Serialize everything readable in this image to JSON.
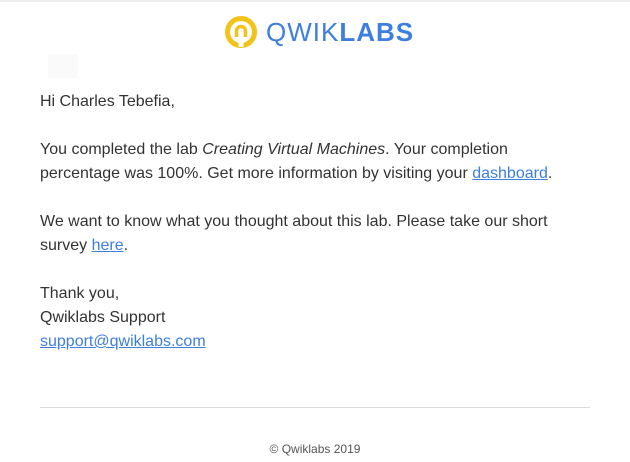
{
  "logo": {
    "text_light": "QWIK",
    "text_bold": "LABS",
    "color": "#3d7ee0",
    "icon_color": "#f2c318"
  },
  "greeting": "Hi Charles Tebefia,",
  "completion": {
    "pre": "You completed the lab ",
    "lab_name": "Creating Virtual Machines",
    "mid1": ". Your completion",
    "mid2": "percentage was 100%. Get more information by visiting your ",
    "link": "dashboard",
    "post": "."
  },
  "survey": {
    "line1": "We want to know what you thought about this lab. Please take our short",
    "pre": "survey ",
    "link": "here",
    "post": "."
  },
  "signoff": {
    "thanks": "Thank you,",
    "name": "Qwiklabs Support",
    "email": "support@qwiklabs.com"
  },
  "footer": "© Qwiklabs 2019"
}
